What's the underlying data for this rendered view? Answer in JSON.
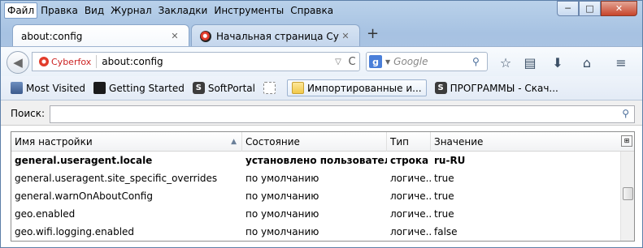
{
  "menu": [
    "Файл",
    "Правка",
    "Вид",
    "Журнал",
    "Закладки",
    "Инструменты",
    "Справка"
  ],
  "window_controls": {
    "minimize": "─",
    "maximize": "□",
    "close": "✕"
  },
  "tabs": [
    {
      "label": "about:config",
      "close": "✕"
    },
    {
      "label": "Начальная страница Cyb…",
      "close": "✕"
    }
  ],
  "new_tab": "+",
  "urlbar": {
    "identity": "Cyberfox",
    "url": "about:config",
    "dropdown": "▽",
    "reload": "C"
  },
  "search": {
    "engine": "g",
    "placeholder": "Google",
    "go": "⚲"
  },
  "toolbar_icons": {
    "star": "☆",
    "library": "▤",
    "download": "⬇",
    "home": "⌂",
    "menu": "≡"
  },
  "bookmarks": [
    {
      "label": "Most Visited"
    },
    {
      "label": "Getting Started"
    },
    {
      "label": "SoftPortal"
    },
    {
      "label": ""
    },
    {
      "label": "Импортированные и..."
    },
    {
      "label": "ПРОГРАММЫ - Скач..."
    }
  ],
  "filter": {
    "label": "Поиск:",
    "value": ""
  },
  "table": {
    "headers": [
      "Имя настройки",
      "Состояние",
      "Тип",
      "Значение"
    ],
    "sort_indicator": "▲",
    "column_picker": "⊞",
    "rows": [
      {
        "name": "general.useragent.locale",
        "state": "установлено пользователем",
        "type": "строка",
        "value": "ru-RU",
        "modified": true
      },
      {
        "name": "general.useragent.site_specific_overrides",
        "state": "по умолчанию",
        "type": "логиче...",
        "value": "true",
        "modified": false
      },
      {
        "name": "general.warnOnAboutConfig",
        "state": "по умолчанию",
        "type": "логиче...",
        "value": "true",
        "modified": false
      },
      {
        "name": "geo.enabled",
        "state": "по умолчанию",
        "type": "логиче...",
        "value": "true",
        "modified": false
      },
      {
        "name": "geo.wifi.logging.enabled",
        "state": "по умолчанию",
        "type": "логиче...",
        "value": "false",
        "modified": false
      }
    ]
  }
}
